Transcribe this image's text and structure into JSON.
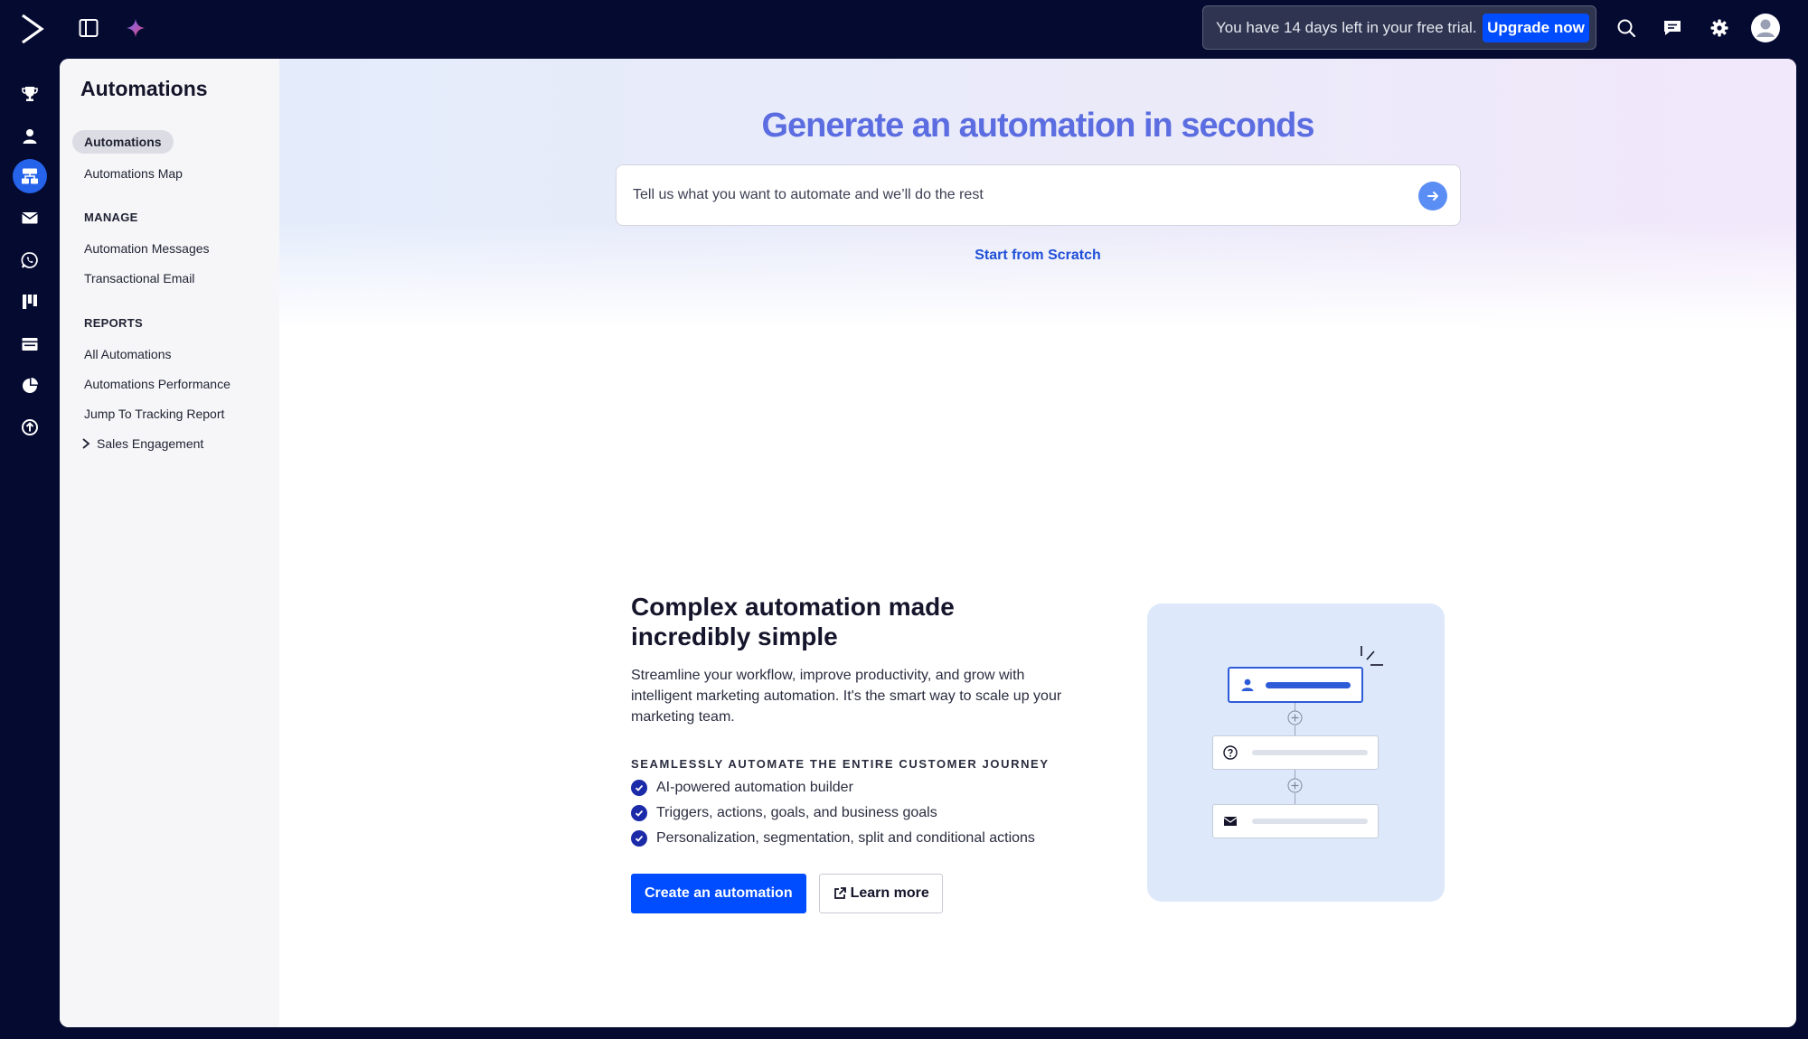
{
  "topbar": {
    "trial_text": "You have 14 days left in your free trial.",
    "upgrade_label": "Upgrade now",
    "icons": [
      "activecampaign-logo",
      "sidebar-toggle-icon",
      "ai-sparkle-icon",
      "search-icon",
      "chat-icon",
      "gear-icon",
      "avatar-icon"
    ]
  },
  "rail": {
    "items": [
      "trophy-icon",
      "contacts-icon",
      "automations-icon",
      "email-icon",
      "whatsapp-icon",
      "deals-icon",
      "site-icon",
      "reports-icon",
      "upgrade-icon"
    ],
    "active": "automations-icon"
  },
  "subnav": {
    "title": "Automations",
    "items": [
      "Automations",
      "Automations Map"
    ],
    "manage_heading": "MANAGE",
    "manage_items": [
      "Automation Messages",
      "Transactional Email"
    ],
    "reports_heading": "REPORTS",
    "reports_items": [
      "All Automations",
      "Automations Performance",
      "Jump To Tracking Report",
      "Sales Engagement"
    ]
  },
  "hero": {
    "title": "Generate an automation in seconds",
    "prompt_placeholder": "Tell us what you want to automate and we’ll do the rest",
    "scratch_link": "Start from Scratch"
  },
  "info": {
    "heading": "Complex automation made incredibly simple",
    "description": "Streamline your workflow, improve productivity, and grow with intelligent marketing automation. It's the smart way to scale up your marketing team.",
    "eyebrow": "SEAMLESSLY AUTOMATE THE ENTIRE CUSTOMER JOURNEY",
    "features": [
      "AI-powered automation builder",
      "Triggers, actions, goals, and business goals",
      "Personalization, segmentation, split and conditional actions"
    ],
    "create_label": "Create an automation",
    "learn_label": "Learn more"
  },
  "colors": {
    "accent": "#004cff",
    "nav_bg": "#050a30",
    "hero_title": "#5b6de0"
  }
}
